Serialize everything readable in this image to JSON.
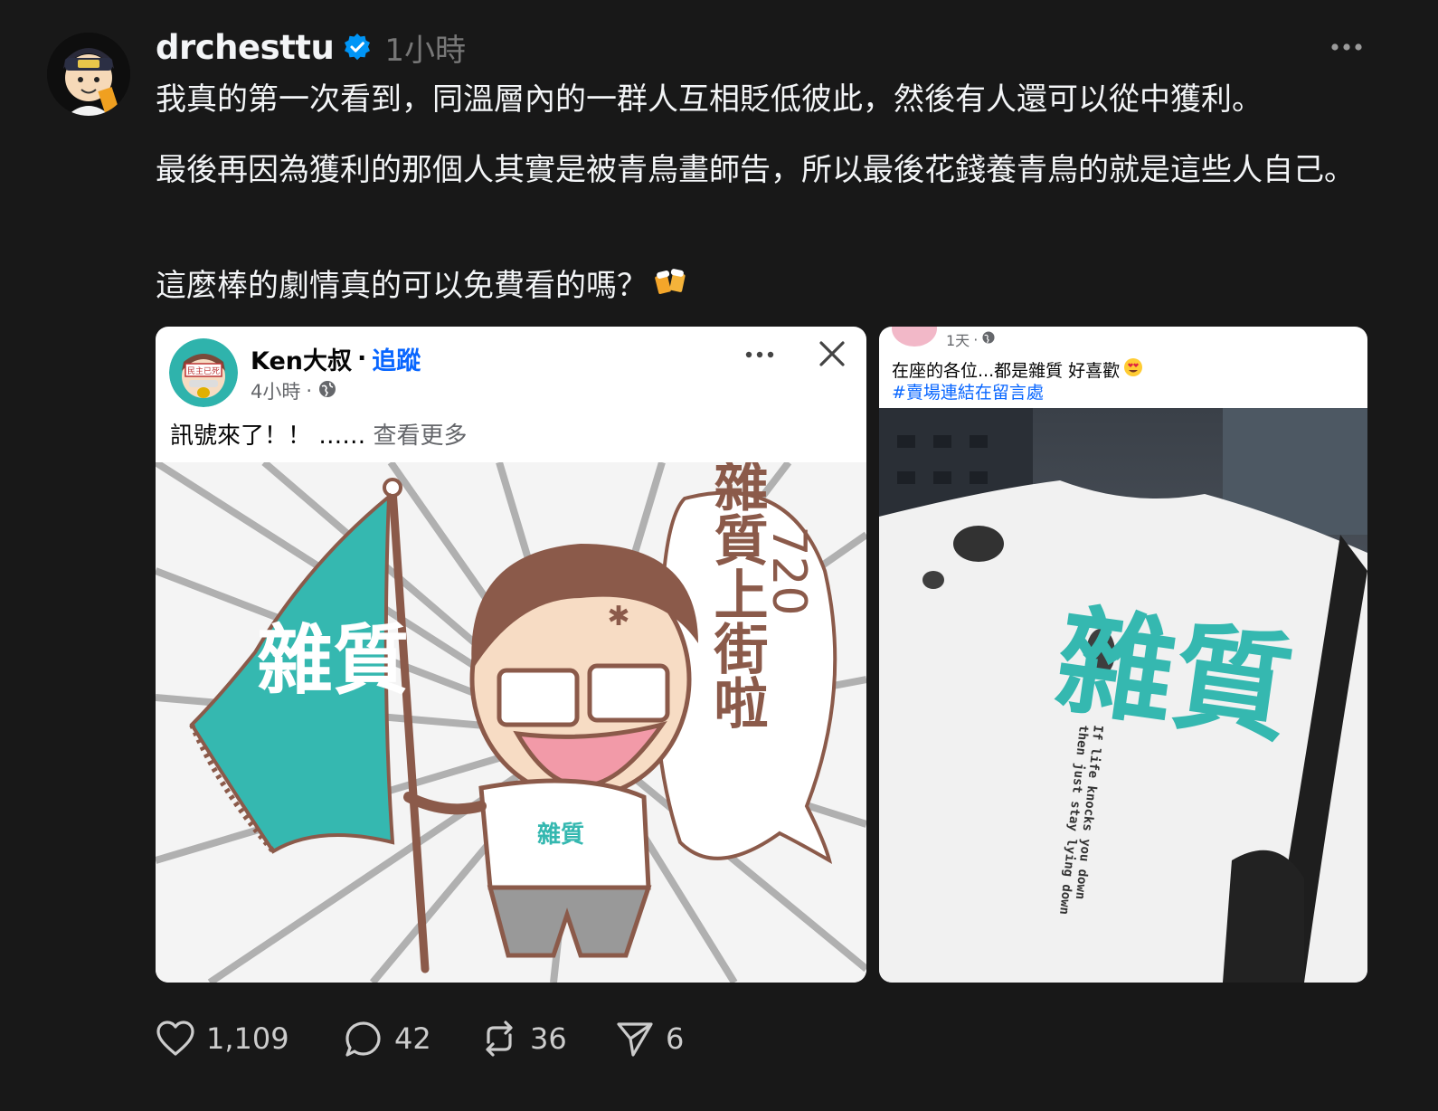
{
  "post": {
    "username": "drchesttu",
    "time": "1小時",
    "paragraphs": [
      "我真的第一次看到，同溫層內的一群人互相貶低彼此，然後有人還可以從中獲利。",
      "最後再因為獲利的那個人其實是被青鳥畫師告，所以最後花錢養青鳥的就是這些人自己。",
      "這麼棒的劇情真的可以免費看的嗎？"
    ],
    "emoji": "beer-mugs-icon"
  },
  "embed_left": {
    "name": "Ken大叔",
    "separator": "·",
    "follow": "追蹤",
    "time": "4小時",
    "meta_separator": "·",
    "caption": "訊號來了！！ ……",
    "see_more": "查看更多",
    "avatar_sign": "民主已死",
    "illustration": {
      "flag_text": "雜質",
      "bubble_line1": "雜質上街啦",
      "bubble_line2": "720",
      "shirt_text": "雜質"
    }
  },
  "embed_right": {
    "time": "1天",
    "meta_separator": "·",
    "caption": "在座的各位...都是雜質 好喜歡",
    "hashtag": "#賣場連結在留言處",
    "shirt_text": "雜質",
    "shirt_line1": "If life knocks you down",
    "shirt_line2": "then just stay lying down"
  },
  "actions": {
    "likes": "1,109",
    "replies": "42",
    "reposts": "36",
    "shares": "6"
  },
  "colors": {
    "background": "#181818",
    "text": "#f3f5f7",
    "secondary": "#777777",
    "verified": "#0095f6",
    "fb_link": "#0866ff",
    "teal": "#35b8b0"
  }
}
